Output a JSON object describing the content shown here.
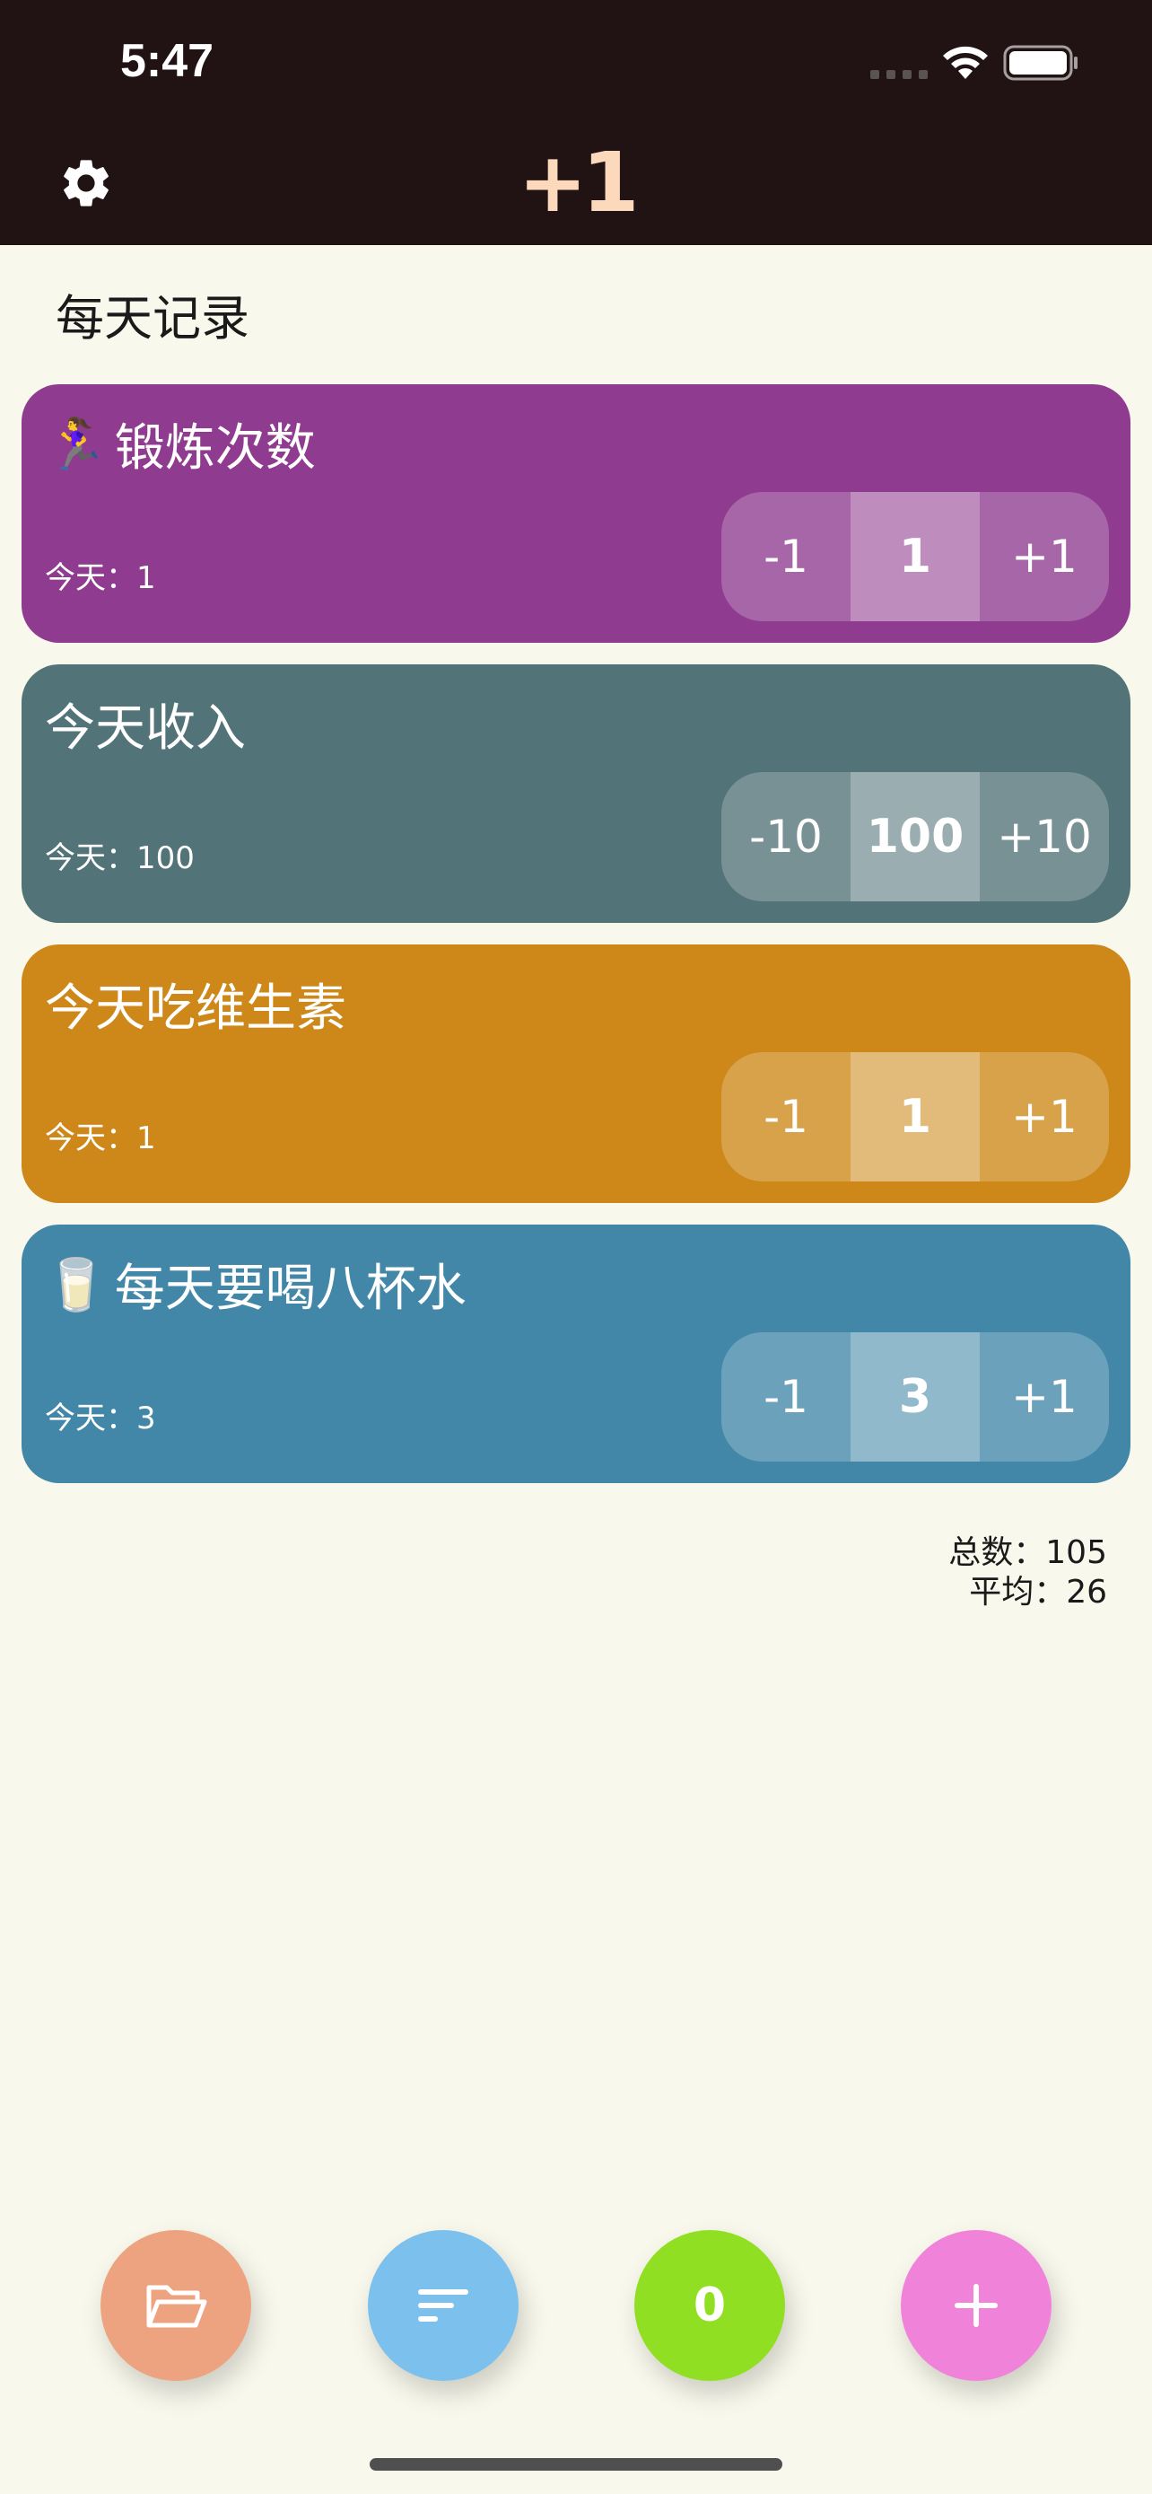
{
  "status_bar": {
    "time": "5:47"
  },
  "header": {
    "title": "+1"
  },
  "section": {
    "title": "每天记录"
  },
  "cards": [
    {
      "emoji": "🏃‍♀️",
      "title": "锻炼次数",
      "today": "今天：1",
      "dec": "-1",
      "value": "1",
      "inc": "+1",
      "color": "#8f3b8f"
    },
    {
      "emoji": "",
      "title": "今天收入",
      "today": "今天：100",
      "dec": "-10",
      "value": "100",
      "inc": "+10",
      "color": "#527378"
    },
    {
      "emoji": "",
      "title": "今天吃维生素",
      "today": "今天：1",
      "dec": "-1",
      "value": "1",
      "inc": "+1",
      "color": "#cd8819"
    },
    {
      "emoji": "🥛",
      "title": "每天要喝八杯水",
      "today": "今天：3",
      "dec": "-1",
      "value": "3",
      "inc": "+1",
      "color": "#4287a8"
    }
  ],
  "summary": {
    "total": "总数：105",
    "average": "平均：26"
  },
  "fabs": {
    "folder_color": "#eda37f",
    "sort_color": "#7cc1ee",
    "count_value": "0",
    "count_color": "#91df22",
    "add_color": "#f182d9"
  }
}
